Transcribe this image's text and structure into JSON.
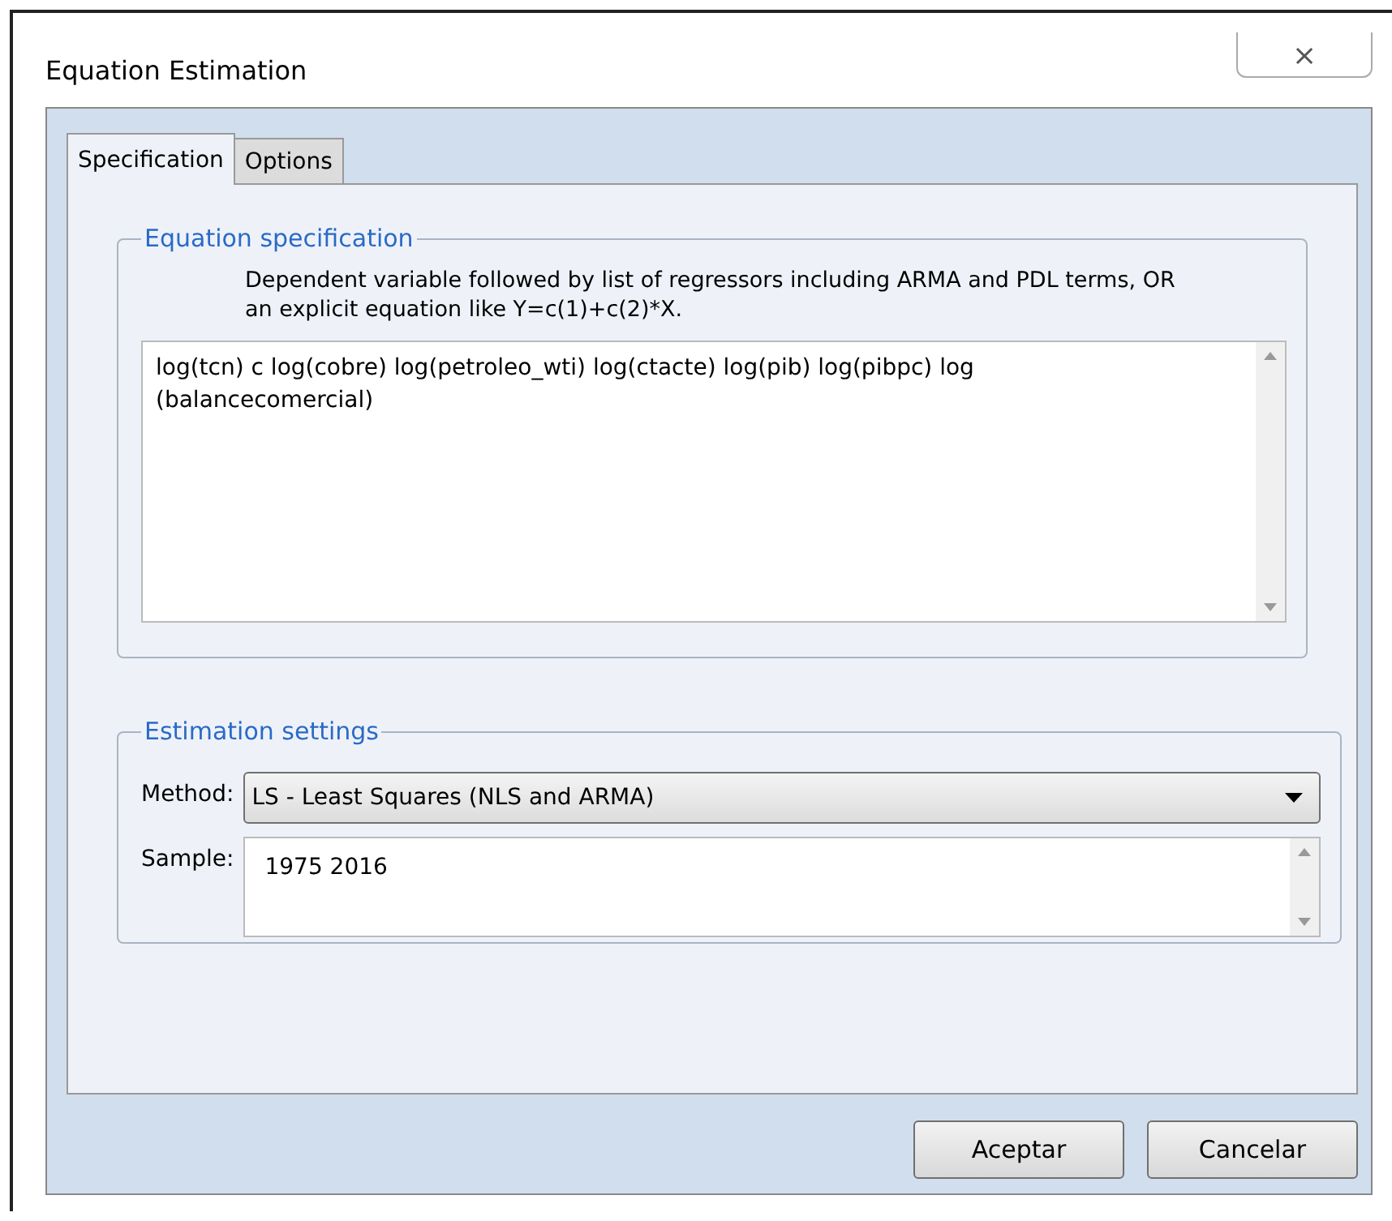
{
  "window": {
    "title": "Equation Estimation",
    "close": "⨯"
  },
  "tabs": [
    {
      "label": "Specification",
      "selected": true
    },
    {
      "label": "Options",
      "selected": false
    }
  ],
  "equation_specification": {
    "legend": "Equation specification",
    "hint": "Dependent variable followed by list of regressors including ARMA and PDL terms, OR an explicit equation like Y=c(1)+c(2)*X.",
    "value": "log(tcn) c log(cobre) log(petroleo_wti) log(ctacte) log(pib) log(pibpc) log (balancecomercial)"
  },
  "estimation_settings": {
    "legend": "Estimation settings",
    "method_label": "Method:",
    "method": "LS  -  Least Squares (NLS and ARMA)",
    "sample_label": "Sample:",
    "sample": "1975 2016"
  },
  "buttons": [
    "Aceptar",
    "Cancelar"
  ]
}
